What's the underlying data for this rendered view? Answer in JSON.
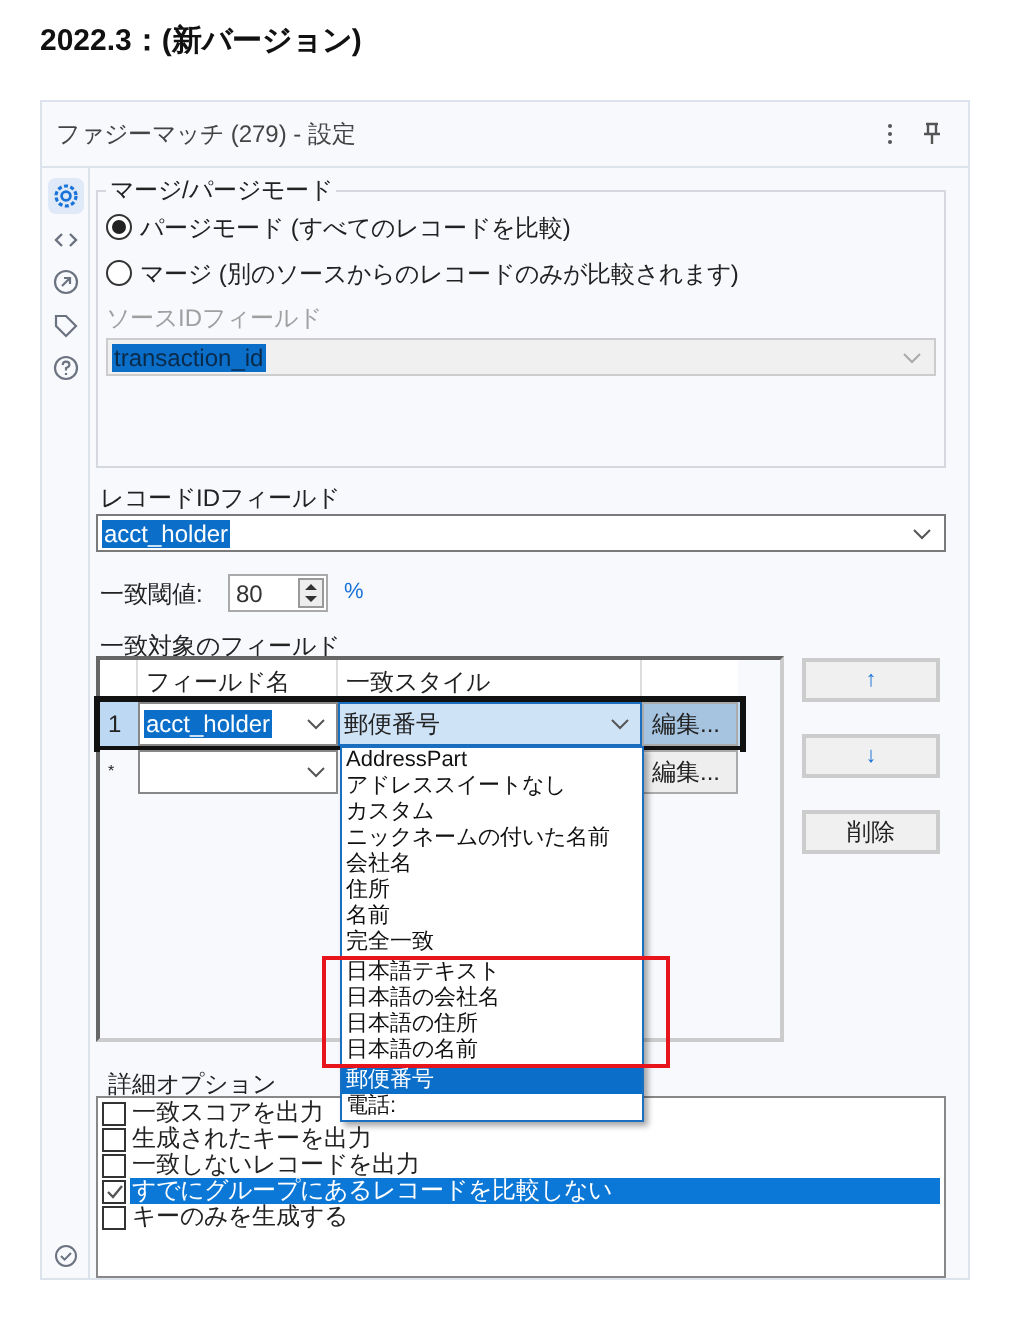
{
  "heading": "2022.3：(新バージョン)",
  "panel": {
    "title": "ファジーマッチ (279) - 設定"
  },
  "side_tabs": [
    {
      "kind": "gear",
      "selected": true
    },
    {
      "kind": "code",
      "selected": false
    },
    {
      "kind": "output",
      "selected": false
    },
    {
      "kind": "tag",
      "selected": false
    },
    {
      "kind": "help",
      "selected": false
    }
  ],
  "mode_group": {
    "legend": "マージ/パージモード",
    "options": [
      {
        "label": "パージモード (すべてのレコードを比較)",
        "selected": true
      },
      {
        "label": "マージ (別のソースからのレコードのみが比較されます)",
        "selected": false
      }
    ],
    "source_id": {
      "label": "ソースIDフィールド",
      "value": "transaction_id",
      "disabled": true
    }
  },
  "record_id": {
    "label": "レコードIDフィールド",
    "value": "acct_holder"
  },
  "threshold": {
    "label": "一致閾値:",
    "value": "80",
    "unit": "%"
  },
  "match_fields": {
    "label": "一致対象のフィールド",
    "columns": [
      "フィールド名",
      "一致スタイル"
    ],
    "rows": [
      {
        "index": "1",
        "field": "acct_holder",
        "style": "郵便番号",
        "button": "編集...",
        "selected": true
      },
      {
        "index": "*",
        "button": "編集...",
        "selected": false
      }
    ]
  },
  "dropdown": {
    "options_before": [
      {
        "label": "AddressPart",
        "selected": false
      },
      {
        "label": "アドレススイートなし",
        "selected": false
      },
      {
        "label": "カスタム",
        "selected": false
      },
      {
        "label": "ニックネームの付いた名前",
        "selected": false
      },
      {
        "label": "会社名",
        "selected": false
      },
      {
        "label": "住所",
        "selected": false
      },
      {
        "label": "名前",
        "selected": false
      },
      {
        "label": "完全一致",
        "selected": false
      }
    ],
    "highlighted_options": [
      {
        "label": "日本語テキスト",
        "selected": false
      },
      {
        "label": "日本語の会社名",
        "selected": false
      },
      {
        "label": "日本語の住所",
        "selected": false
      },
      {
        "label": "日本語の名前",
        "selected": false
      }
    ],
    "options_after": [
      {
        "label": "郵便番号",
        "selected": true
      },
      {
        "label": "電話:",
        "selected": false
      }
    ]
  },
  "side_buttons": [
    "↑",
    "↓",
    "削除"
  ],
  "options_group": {
    "label": "詳細オプション",
    "items": [
      {
        "label": "一致スコアを出力",
        "checked": false,
        "selected": false
      },
      {
        "label": "生成されたキーを出力",
        "checked": false,
        "selected": false
      },
      {
        "label": "一致しないレコードを出力",
        "checked": false,
        "selected": false
      },
      {
        "label": "すでにグループにあるレコードを比較しない",
        "checked": true,
        "selected": true
      },
      {
        "label": "キーのみを生成する",
        "checked": false,
        "selected": false
      }
    ]
  }
}
